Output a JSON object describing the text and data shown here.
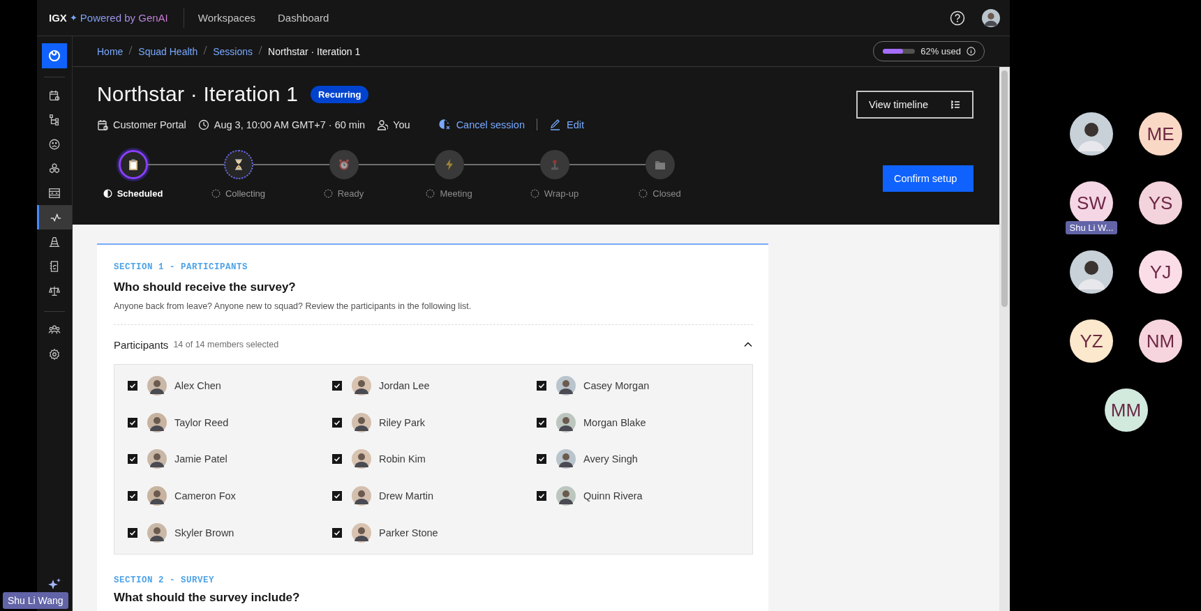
{
  "app": {
    "brand": "IGX",
    "brand_mark": "✦",
    "tagline": "Powered by GenAI",
    "nav": [
      {
        "label": "Workspaces"
      },
      {
        "label": "Dashboard"
      }
    ]
  },
  "sidebar": {
    "items": [
      {
        "kind": "calendar",
        "selected": false
      },
      {
        "kind": "tree",
        "selected": false
      },
      {
        "kind": "sad",
        "selected": false
      },
      {
        "kind": "cubes",
        "selected": false
      },
      {
        "kind": "panel",
        "selected": false
      },
      {
        "kind": "pulse",
        "selected": true
      },
      {
        "kind": "cone",
        "selected": false
      },
      {
        "kind": "document",
        "selected": false
      },
      {
        "kind": "scale",
        "selected": false
      }
    ],
    "admin_items": [
      {
        "kind": "people",
        "selected": false
      },
      {
        "kind": "gear",
        "selected": false
      }
    ]
  },
  "breadcrumb": [
    "Home",
    "Squad Health",
    "Sessions",
    "Northstar · Iteration 1"
  ],
  "usage": {
    "level": 0.62,
    "label": "62% used"
  },
  "session": {
    "title": "Northstar · Iteration 1",
    "badge": "Recurring",
    "meta": [
      {
        "kind": "project",
        "text": "Customer Portal"
      },
      {
        "kind": "time",
        "text": "Aug 3, 10:00 AM GMT+7 · 60 min"
      },
      {
        "kind": "owner",
        "text": "You"
      }
    ],
    "actions": [
      {
        "kind": "cancel",
        "label": "Cancel session"
      },
      {
        "kind": "edit",
        "label": "Edit"
      }
    ],
    "view_timeline": "View timeline",
    "confirm": "Confirm setup"
  },
  "stages": [
    {
      "label": "Scheduled",
      "kind": "clipboard",
      "selected": true,
      "enabled": true
    },
    {
      "label": "Collecting",
      "kind": "hourglass",
      "selected": false,
      "enabled": true
    },
    {
      "label": "Ready",
      "kind": "alarm",
      "selected": false,
      "enabled": false
    },
    {
      "label": "Meeting",
      "kind": "bolt",
      "selected": false,
      "enabled": false
    },
    {
      "label": "Wrap-up",
      "kind": "joystick",
      "selected": false,
      "enabled": false
    },
    {
      "label": "Closed",
      "kind": "folder",
      "selected": false,
      "enabled": false
    }
  ],
  "section1": {
    "eyebrow": "SECTION 1 - PARTICIPANTS",
    "question": "Who should receive the survey?",
    "hint": "Anyone back from leave? Anyone new to squad? Review the participants in the following list.",
    "participants": {
      "title": "Participants",
      "count": "14 of 14 members selected",
      "expanded": true,
      "members": [
        {
          "name": "Alex Chen",
          "checked": true
        },
        {
          "name": "Jordan Lee",
          "checked": true
        },
        {
          "name": "Casey Morgan",
          "checked": true
        },
        {
          "name": "Taylor Reed",
          "checked": true
        },
        {
          "name": "Riley Park",
          "checked": true
        },
        {
          "name": "Morgan Blake",
          "checked": true
        },
        {
          "name": "Jamie Patel",
          "checked": true
        },
        {
          "name": "Robin Kim",
          "checked": true
        },
        {
          "name": "Avery Singh",
          "checked": true
        },
        {
          "name": "Cameron Fox",
          "checked": true
        },
        {
          "name": "Drew Martin",
          "checked": true
        },
        {
          "name": "Quinn Rivera",
          "checked": true
        },
        {
          "name": "Skyler Brown",
          "checked": true
        },
        {
          "name": "Parker Stone",
          "checked": true
        }
      ]
    }
  },
  "section2": {
    "eyebrow": "SECTION 2 - SURVEY",
    "question": "What should the survey include?"
  },
  "call": {
    "tiles": [
      {
        "kind": "photo"
      },
      {
        "kind": "initials",
        "initials": "ME",
        "color": "#f9d8c6"
      },
      {
        "kind": "initials",
        "initials": "SW",
        "color": "#f5d6e4",
        "label": "Shu Li W..."
      },
      {
        "kind": "initials",
        "initials": "YS",
        "color": "#f3d3dc"
      },
      {
        "kind": "photo"
      },
      {
        "kind": "initials",
        "initials": "YJ",
        "color": "#fadde7"
      },
      {
        "kind": "initials",
        "initials": "YZ",
        "color": "#fce8cc"
      },
      {
        "kind": "initials",
        "initials": "NM",
        "color": "#f7d5de"
      },
      {
        "kind": "initials",
        "initials": "MM",
        "color": "#d2e9de"
      }
    ],
    "presenter": "Shu Li Wang"
  }
}
